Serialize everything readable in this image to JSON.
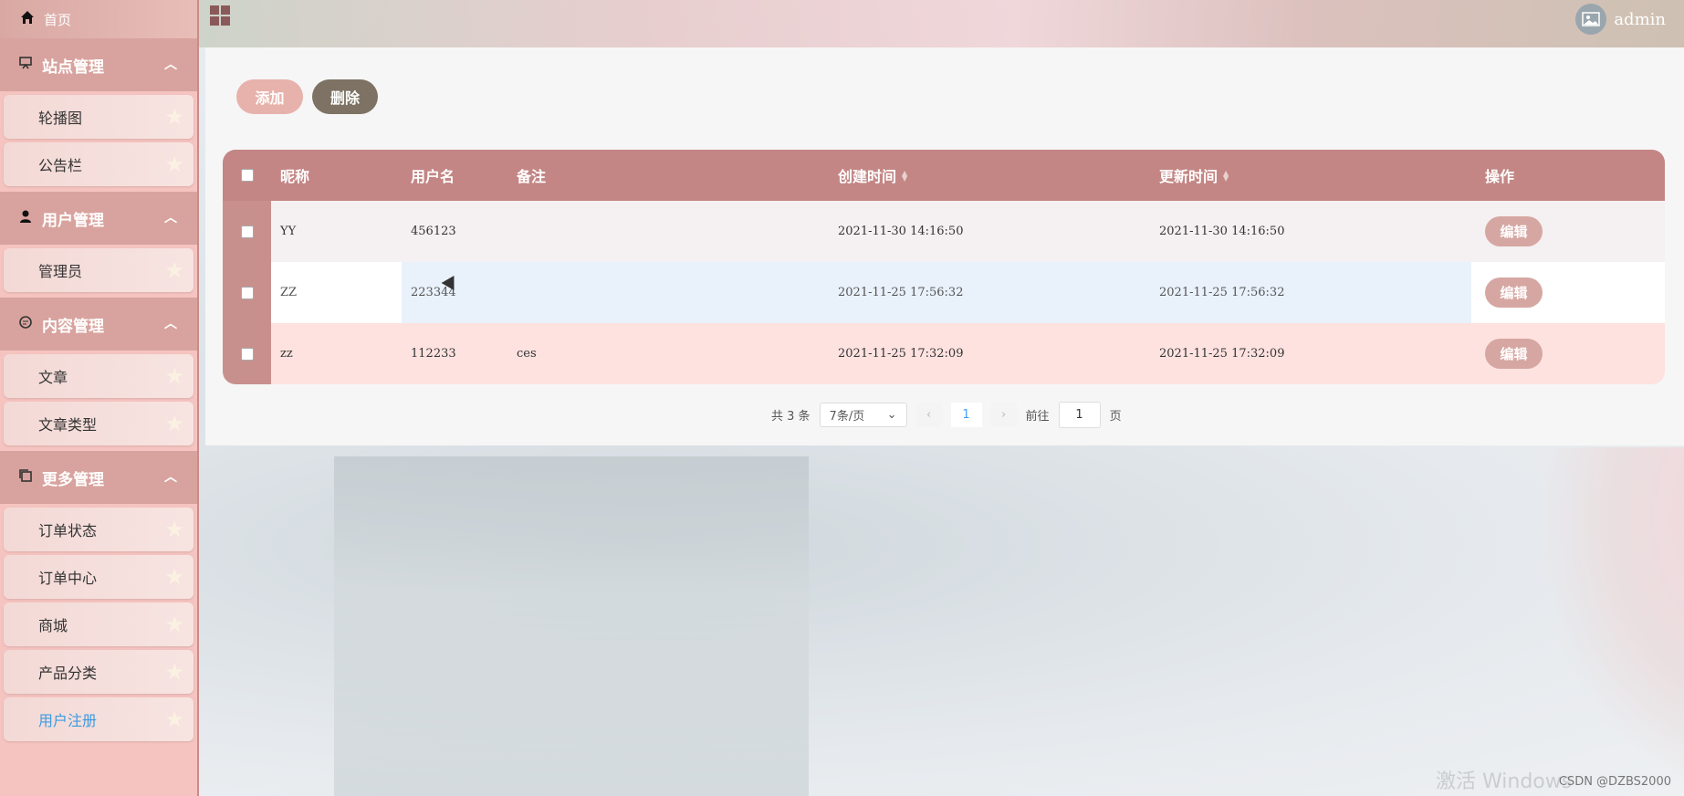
{
  "sidebar": {
    "home_label": "首页",
    "groups": [
      {
        "label": "站点管理",
        "items": [
          "轮播图",
          "公告栏"
        ]
      },
      {
        "label": "用户管理",
        "items": [
          "管理员"
        ]
      },
      {
        "label": "内容管理",
        "items": [
          "文章",
          "文章类型"
        ]
      },
      {
        "label": "更多管理",
        "items": [
          "订单状态",
          "订单中心",
          "商城",
          "产品分类",
          "用户注册"
        ]
      }
    ]
  },
  "header": {
    "username": "admin"
  },
  "toolbar": {
    "add_label": "添加",
    "delete_label": "删除"
  },
  "table": {
    "columns": {
      "nickname": "昵称",
      "username": "用户名",
      "note": "备注",
      "created": "创建时间",
      "updated": "更新时间",
      "ops": "操作"
    },
    "rows": [
      {
        "nickname": "YY",
        "username": "456123",
        "note": "",
        "created": "2021-11-30 14:16:50",
        "updated": "2021-11-30 14:16:50",
        "edit": "编辑"
      },
      {
        "nickname": "ZZ",
        "username": "223344",
        "note": "",
        "created": "2021-11-25 17:56:32",
        "updated": "2021-11-25 17:56:32",
        "edit": "编辑"
      },
      {
        "nickname": "zz",
        "username": "112233",
        "note": "ces",
        "created": "2021-11-25 17:32:09",
        "updated": "2021-11-25 17:32:09",
        "edit": "编辑"
      }
    ]
  },
  "pagination": {
    "total": "共 3 条",
    "page_size": "7条/页",
    "current_page": "1",
    "goto_label": "前往",
    "goto_value": "1",
    "page_suffix": "页"
  },
  "overlay": {
    "watermark": "激活 Windows",
    "credit": "CSDN @DZBS2000"
  }
}
